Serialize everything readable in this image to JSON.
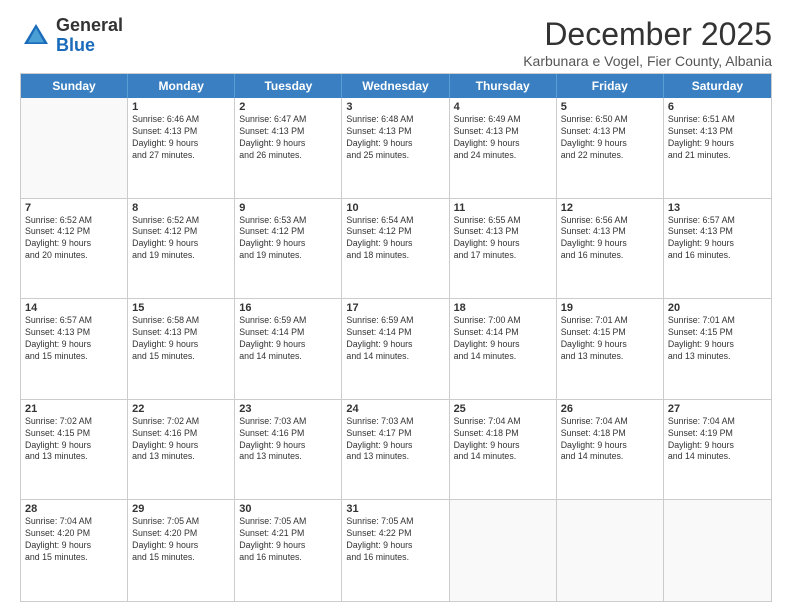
{
  "logo": {
    "general": "General",
    "blue": "Blue"
  },
  "header": {
    "month": "December 2025",
    "location": "Karbunara e Vogel, Fier County, Albania"
  },
  "days": [
    "Sunday",
    "Monday",
    "Tuesday",
    "Wednesday",
    "Thursday",
    "Friday",
    "Saturday"
  ],
  "weeks": [
    [
      {
        "day": "",
        "info": ""
      },
      {
        "day": "1",
        "info": "Sunrise: 6:46 AM\nSunset: 4:13 PM\nDaylight: 9 hours\nand 27 minutes."
      },
      {
        "day": "2",
        "info": "Sunrise: 6:47 AM\nSunset: 4:13 PM\nDaylight: 9 hours\nand 26 minutes."
      },
      {
        "day": "3",
        "info": "Sunrise: 6:48 AM\nSunset: 4:13 PM\nDaylight: 9 hours\nand 25 minutes."
      },
      {
        "day": "4",
        "info": "Sunrise: 6:49 AM\nSunset: 4:13 PM\nDaylight: 9 hours\nand 24 minutes."
      },
      {
        "day": "5",
        "info": "Sunrise: 6:50 AM\nSunset: 4:13 PM\nDaylight: 9 hours\nand 22 minutes."
      },
      {
        "day": "6",
        "info": "Sunrise: 6:51 AM\nSunset: 4:13 PM\nDaylight: 9 hours\nand 21 minutes."
      }
    ],
    [
      {
        "day": "7",
        "info": "Sunrise: 6:52 AM\nSunset: 4:12 PM\nDaylight: 9 hours\nand 20 minutes."
      },
      {
        "day": "8",
        "info": "Sunrise: 6:52 AM\nSunset: 4:12 PM\nDaylight: 9 hours\nand 19 minutes."
      },
      {
        "day": "9",
        "info": "Sunrise: 6:53 AM\nSunset: 4:12 PM\nDaylight: 9 hours\nand 19 minutes."
      },
      {
        "day": "10",
        "info": "Sunrise: 6:54 AM\nSunset: 4:12 PM\nDaylight: 9 hours\nand 18 minutes."
      },
      {
        "day": "11",
        "info": "Sunrise: 6:55 AM\nSunset: 4:13 PM\nDaylight: 9 hours\nand 17 minutes."
      },
      {
        "day": "12",
        "info": "Sunrise: 6:56 AM\nSunset: 4:13 PM\nDaylight: 9 hours\nand 16 minutes."
      },
      {
        "day": "13",
        "info": "Sunrise: 6:57 AM\nSunset: 4:13 PM\nDaylight: 9 hours\nand 16 minutes."
      }
    ],
    [
      {
        "day": "14",
        "info": "Sunrise: 6:57 AM\nSunset: 4:13 PM\nDaylight: 9 hours\nand 15 minutes."
      },
      {
        "day": "15",
        "info": "Sunrise: 6:58 AM\nSunset: 4:13 PM\nDaylight: 9 hours\nand 15 minutes."
      },
      {
        "day": "16",
        "info": "Sunrise: 6:59 AM\nSunset: 4:14 PM\nDaylight: 9 hours\nand 14 minutes."
      },
      {
        "day": "17",
        "info": "Sunrise: 6:59 AM\nSunset: 4:14 PM\nDaylight: 9 hours\nand 14 minutes."
      },
      {
        "day": "18",
        "info": "Sunrise: 7:00 AM\nSunset: 4:14 PM\nDaylight: 9 hours\nand 14 minutes."
      },
      {
        "day": "19",
        "info": "Sunrise: 7:01 AM\nSunset: 4:15 PM\nDaylight: 9 hours\nand 13 minutes."
      },
      {
        "day": "20",
        "info": "Sunrise: 7:01 AM\nSunset: 4:15 PM\nDaylight: 9 hours\nand 13 minutes."
      }
    ],
    [
      {
        "day": "21",
        "info": "Sunrise: 7:02 AM\nSunset: 4:15 PM\nDaylight: 9 hours\nand 13 minutes."
      },
      {
        "day": "22",
        "info": "Sunrise: 7:02 AM\nSunset: 4:16 PM\nDaylight: 9 hours\nand 13 minutes."
      },
      {
        "day": "23",
        "info": "Sunrise: 7:03 AM\nSunset: 4:16 PM\nDaylight: 9 hours\nand 13 minutes."
      },
      {
        "day": "24",
        "info": "Sunrise: 7:03 AM\nSunset: 4:17 PM\nDaylight: 9 hours\nand 13 minutes."
      },
      {
        "day": "25",
        "info": "Sunrise: 7:04 AM\nSunset: 4:18 PM\nDaylight: 9 hours\nand 14 minutes."
      },
      {
        "day": "26",
        "info": "Sunrise: 7:04 AM\nSunset: 4:18 PM\nDaylight: 9 hours\nand 14 minutes."
      },
      {
        "day": "27",
        "info": "Sunrise: 7:04 AM\nSunset: 4:19 PM\nDaylight: 9 hours\nand 14 minutes."
      }
    ],
    [
      {
        "day": "28",
        "info": "Sunrise: 7:04 AM\nSunset: 4:20 PM\nDaylight: 9 hours\nand 15 minutes."
      },
      {
        "day": "29",
        "info": "Sunrise: 7:05 AM\nSunset: 4:20 PM\nDaylight: 9 hours\nand 15 minutes."
      },
      {
        "day": "30",
        "info": "Sunrise: 7:05 AM\nSunset: 4:21 PM\nDaylight: 9 hours\nand 16 minutes."
      },
      {
        "day": "31",
        "info": "Sunrise: 7:05 AM\nSunset: 4:22 PM\nDaylight: 9 hours\nand 16 minutes."
      },
      {
        "day": "",
        "info": ""
      },
      {
        "day": "",
        "info": ""
      },
      {
        "day": "",
        "info": ""
      }
    ]
  ]
}
